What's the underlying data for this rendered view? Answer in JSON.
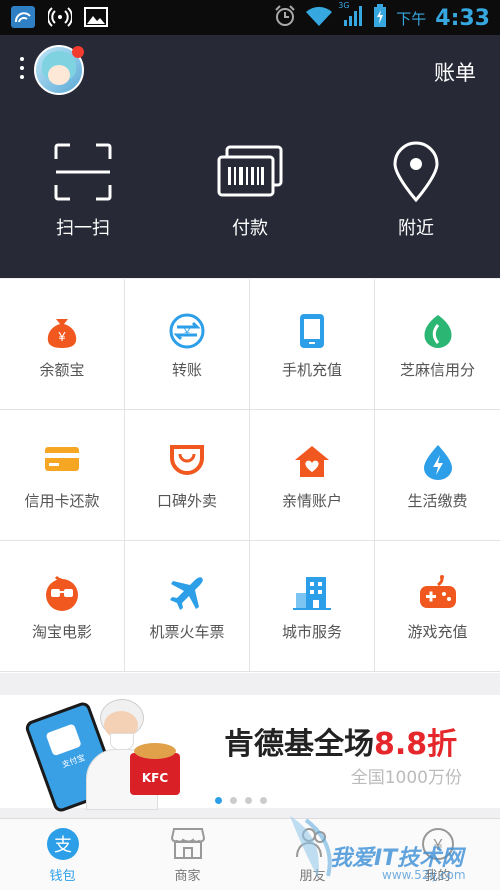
{
  "status_bar": {
    "ampm": "下午",
    "time": "4:33",
    "network_3g": "3G"
  },
  "header": {
    "bill_label": "账单",
    "actions": [
      {
        "label": "扫一扫",
        "icon": "scan-icon"
      },
      {
        "label": "付款",
        "icon": "barcode-pay-icon"
      },
      {
        "label": "附近",
        "icon": "location-pin-icon"
      }
    ]
  },
  "grid": {
    "items": [
      {
        "label": "余额宝",
        "icon": "money-bag-icon",
        "color": "#f0581f"
      },
      {
        "label": "转账",
        "icon": "transfer-icon",
        "color": "#2d9fe8"
      },
      {
        "label": "手机充值",
        "icon": "phone-icon",
        "color": "#2d9fe8"
      },
      {
        "label": "芝麻信用分",
        "icon": "sesame-leaf-icon",
        "color": "#2bb673"
      },
      {
        "label": "信用卡还款",
        "icon": "credit-card-icon",
        "color": "#f5a623"
      },
      {
        "label": "口碑外卖",
        "icon": "smile-bag-icon",
        "color": "#f0581f"
      },
      {
        "label": "亲情账户",
        "icon": "family-home-icon",
        "color": "#f0581f"
      },
      {
        "label": "生活缴费",
        "icon": "lightning-drop-icon",
        "color": "#2d9fe8"
      },
      {
        "label": "淘宝电影",
        "icon": "movie-glasses-icon",
        "color": "#f0581f"
      },
      {
        "label": "机票火车票",
        "icon": "airplane-icon",
        "color": "#2d9fe8"
      },
      {
        "label": "城市服务",
        "icon": "city-building-icon",
        "color": "#2d9fe8"
      },
      {
        "label": "游戏充值",
        "icon": "gamepad-icon",
        "color": "#f0581f"
      }
    ]
  },
  "banner": {
    "title_main": "肯德基全场",
    "title_discount": "8.8折",
    "subtitle": "全国1000万份",
    "phone_text": "支付宝",
    "logo_text": "KFC",
    "accent": "#e5262b",
    "pager_active": 0,
    "pager_count": 4
  },
  "tabs": [
    {
      "label": "钱包",
      "icon": "wallet-icon",
      "active": true
    },
    {
      "label": "商家",
      "icon": "shop-icon",
      "active": false
    },
    {
      "label": "朋友",
      "icon": "friends-icon",
      "active": false
    },
    {
      "label": "我的",
      "icon": "my-assets-icon",
      "active": false
    }
  ],
  "watermark": "我爱IT技术网",
  "watermark_url": "www.52ij.com"
}
